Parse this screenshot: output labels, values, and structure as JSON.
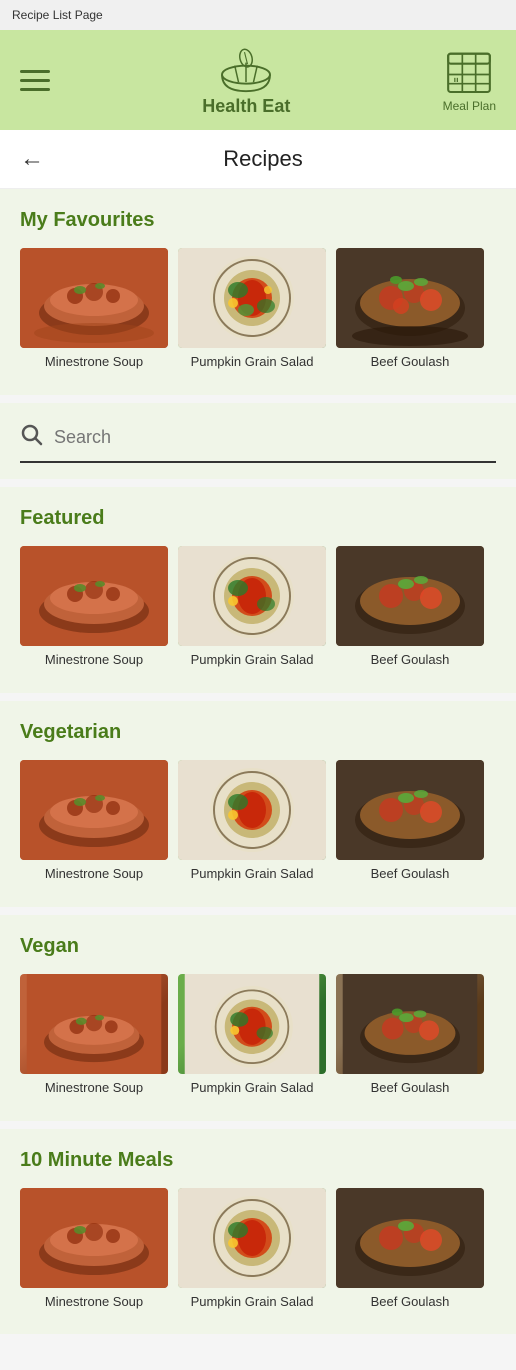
{
  "statusBar": {
    "label": "Recipe List Page"
  },
  "header": {
    "logoText": "Health Eat",
    "mealPlanLabel": "Meal Plan"
  },
  "nav": {
    "backLabel": "←",
    "title": "Recipes"
  },
  "sections": [
    {
      "id": "favourites",
      "title": "My Favourites",
      "recipes": [
        {
          "name": "Minestrone Soup",
          "type": "minestrone"
        },
        {
          "name": "Pumpkin Grain\nSalad",
          "type": "pumpkin"
        },
        {
          "name": "Beef Goulash",
          "type": "goulash"
        }
      ]
    },
    {
      "id": "featured",
      "title": "Featured",
      "recipes": [
        {
          "name": "Minestrone Soup",
          "type": "minestrone"
        },
        {
          "name": "Pumpkin Grain\nSalad",
          "type": "pumpkin"
        },
        {
          "name": "Beef Goulash",
          "type": "goulash"
        }
      ]
    },
    {
      "id": "vegetarian",
      "title": "Vegetarian",
      "recipes": [
        {
          "name": "Minestrone Soup",
          "type": "minestrone"
        },
        {
          "name": "Pumpkin Grain\nSalad",
          "type": "pumpkin"
        },
        {
          "name": "Beef Goulash",
          "type": "goulash"
        }
      ]
    },
    {
      "id": "vegan",
      "title": "Vegan",
      "recipes": [
        {
          "name": "Minestrone Soup",
          "type": "minestrone"
        },
        {
          "name": "Pumpkin Grain\nSalad",
          "type": "pumpkin"
        },
        {
          "name": "Beef Goulash",
          "type": "goulash"
        }
      ]
    },
    {
      "id": "ten-minute",
      "title": "10 Minute Meals",
      "recipes": [
        {
          "name": "Minestrone Soup",
          "type": "minestrone"
        },
        {
          "name": "Pumpkin Grain\nSalad",
          "type": "pumpkin"
        },
        {
          "name": "Beef Goulash",
          "type": "goulash"
        }
      ]
    }
  ],
  "search": {
    "placeholder": "Search"
  },
  "colors": {
    "headerBg": "#c8e6a0",
    "sectionBg": "#f0f5e8",
    "titleColor": "#4a7c1a",
    "logoColor": "#4a6e2a"
  }
}
